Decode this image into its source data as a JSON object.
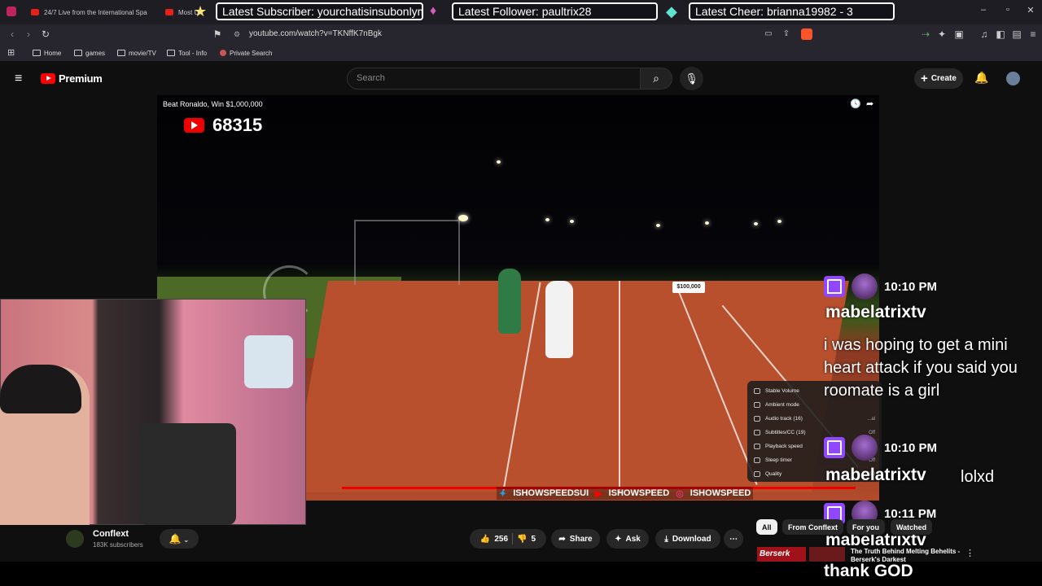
{
  "browser": {
    "tabs": [
      "24/7 Live from the International Spa",
      "Most U"
    ],
    "url": "youtube.com/watch?v=TKNffK7nBgk",
    "bookmarks": [
      "Home",
      "games",
      "movie/TV",
      "Tool - Info",
      "Private Search"
    ]
  },
  "stream_overlay": {
    "latest_subscriber": "Latest Subscriber: yourchatisinsubonlymode",
    "latest_follower": "Latest Follower: paultrix28",
    "latest_cheer": "Latest Cheer: brianna19982 - 3"
  },
  "youtube": {
    "logo_text": "Premium",
    "search_placeholder": "Search",
    "create_label": "Create"
  },
  "video": {
    "title_overlay": "Beat Ronaldo, Win $1,000,000",
    "counter": "68315",
    "prize_sign": "$100,000",
    "social_handles": [
      "ISHOWSPEEDSUI",
      "ISHOWSPEED",
      "ISHOWSPEED"
    ],
    "progress_fraction": 0.97
  },
  "settings_menu": {
    "items": [
      {
        "label": "Stable Volume",
        "value": ""
      },
      {
        "label": "Ambient mode",
        "value": ""
      },
      {
        "label": "Audio track (16)",
        "value": "...al"
      },
      {
        "label": "Subtitles/CC (19)",
        "value": "Off"
      },
      {
        "label": "Playback speed",
        "value": ""
      },
      {
        "label": "Sleep timer",
        "value": "Off"
      },
      {
        "label": "Quality",
        "value": "1080"
      }
    ]
  },
  "channel": {
    "name": "Conflext",
    "subscribers": "183K subscribers"
  },
  "actions": {
    "likes": "256",
    "dislikes": "5",
    "share": "Share",
    "ask": "Ask",
    "download": "Download"
  },
  "chips": [
    "All",
    "From Conflext",
    "For you",
    "Watched"
  ],
  "recommendation": {
    "thumb_text": "Berserk",
    "title": "The Truth Behind Melting Behelits - Berserk's Darkest"
  },
  "chat": [
    {
      "time": "10:10 PM",
      "user": "mabelatrixtv",
      "message": "i was hoping to get a mini heart attack if you said you roomate is a girl"
    },
    {
      "time": "10:10 PM",
      "user": "mabelatrixtv",
      "message": "lolxd"
    },
    {
      "time": "10:11 PM",
      "user": "mabelatrixtv",
      "message": "thank GOD"
    }
  ],
  "colors": {
    "yt_red": "#ff0000",
    "twitch_purple": "#9146ff",
    "background": "#0f0f0f"
  }
}
